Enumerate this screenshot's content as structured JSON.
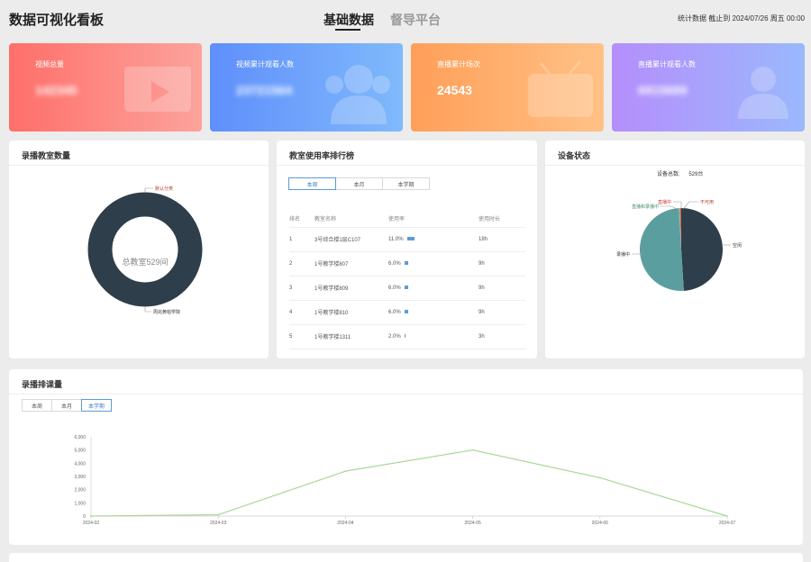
{
  "header": {
    "app_title": "数据可视化看板",
    "tabs": [
      {
        "label": "基础数据",
        "active": true
      },
      {
        "label": "督导平台",
        "active": false
      }
    ],
    "stat_time": "统计数据 截止到 2024/07/26  周五  00:00"
  },
  "kpis": [
    {
      "label": "视频总量",
      "value": "142345",
      "blurred": true,
      "icon": "video-icon"
    },
    {
      "label": "视频累计观看人数",
      "value": "23721564",
      "blurred": true,
      "icon": "people-icon"
    },
    {
      "label": "直播累计场次",
      "value": "24543",
      "blurred": false,
      "icon": "tv-icon"
    },
    {
      "label": "直播累计观看人数",
      "value": "6915689",
      "blurred": true,
      "icon": "audience-icon"
    }
  ],
  "classroom_count": {
    "title": "录播教室数量",
    "center_label": "总教室529间",
    "labels": [
      "默认分类",
      "周兆黄柏学院"
    ],
    "ring_color": "#2e3e4a"
  },
  "usage_ranking": {
    "title": "教室使用率排行榜",
    "periods": [
      "本周",
      "本月",
      "本学期"
    ],
    "active_period": 0,
    "columns": [
      "排名",
      "教室名称",
      "使用率",
      "使用时长"
    ],
    "rows": [
      {
        "rank": "1",
        "name": "3号综合楼1层C107",
        "rate": "11.0%",
        "rate_value": 11.0,
        "duration": "18h"
      },
      {
        "rank": "2",
        "name": "1号教学楼807",
        "rate": "6.0%",
        "rate_value": 6.0,
        "duration": "9h"
      },
      {
        "rank": "3",
        "name": "1号教学楼809",
        "rate": "6.0%",
        "rate_value": 6.0,
        "duration": "9h"
      },
      {
        "rank": "4",
        "name": "1号教学楼810",
        "rate": "6.0%",
        "rate_value": 6.0,
        "duration": "9h"
      },
      {
        "rank": "5",
        "name": "1号教学楼1311",
        "rate": "2.0%",
        "rate_value": 2.0,
        "duration": "3h"
      }
    ],
    "bar_color": "#5b9bd5"
  },
  "device_status": {
    "title": "设备状态",
    "total_label": "设备总数:",
    "total_value": "529台",
    "slices": [
      {
        "label": "空闲",
        "value": 49,
        "color": "#2e3e4a"
      },
      {
        "label": "录播中",
        "value": 50,
        "color": "#5b9ea0"
      },
      {
        "label": "直播和录播中",
        "value": 0.4,
        "color": "#7fb69a"
      },
      {
        "label": "直播中",
        "value": 0.3,
        "color": "#e07a5f"
      },
      {
        "label": "不可用",
        "value": 0.3,
        "color": "#c0392b"
      }
    ]
  },
  "schedule": {
    "title": "录播排课量",
    "periods": [
      "本周",
      "本月",
      "本学期"
    ],
    "active_period": 2
  },
  "chart_data": {
    "type": "line",
    "x": [
      "2024-02",
      "2024-03",
      "2024-04",
      "2024-05",
      "2024-06",
      "2024-07"
    ],
    "series": [
      {
        "values": [
          0,
          100,
          3400,
          5000,
          2900,
          0
        ]
      }
    ],
    "ylim": [
      0,
      6000
    ],
    "yticks": [
      "0",
      "1,000",
      "2,000",
      "3,000",
      "4,000",
      "5,000",
      "6,000"
    ],
    "line_color": "#a8d89a",
    "grid": false
  }
}
